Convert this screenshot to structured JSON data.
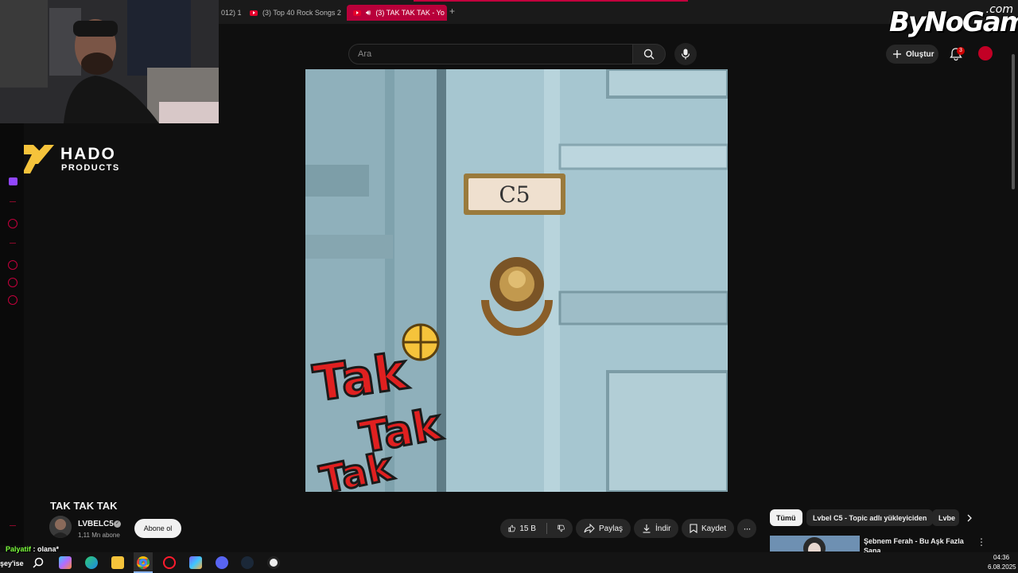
{
  "browser": {
    "tabs": [
      {
        "label": "012) 1"
      },
      {
        "label": "(3) Top 40 Rock Songs 2"
      },
      {
        "label": "(3) TAK TAK TAK - Yo"
      }
    ]
  },
  "watermark": {
    "main": "ByNoGame",
    "suffix": ".com"
  },
  "sponsor": {
    "name": "HADO",
    "sub": "PRODUCTS"
  },
  "header": {
    "search_placeholder": "Ara",
    "create_label": "Oluştur",
    "notification_count": "3"
  },
  "video": {
    "plate_text": "C5",
    "art_text": [
      "Tak",
      "Tak",
      "Tak"
    ]
  },
  "watch": {
    "title": "TAK TAK TAK",
    "channel": {
      "name": "LVBELC5",
      "subscribers": "1,11 Mn abone",
      "subscribe_label": "Abone ol"
    },
    "actions": {
      "likes": "15 B",
      "share": "Paylaş",
      "download": "İndir",
      "save": "Kaydet"
    }
  },
  "related": {
    "chips": [
      "Tümü",
      "Lvbel C5 - Topic adlı yükleyiciden",
      "Lvbe"
    ],
    "first_item_title": "Şebnem Ferah - Bu Aşk Fazla Sana"
  },
  "chat": {
    "user": "Palyatif",
    "message": ": olana*"
  },
  "taskbar": {
    "left_text": "şey'ise",
    "time": "04:36",
    "date": "6.08.2025"
  },
  "colors": {
    "accent": "#c2003d",
    "youtube_red": "#cc0000"
  }
}
